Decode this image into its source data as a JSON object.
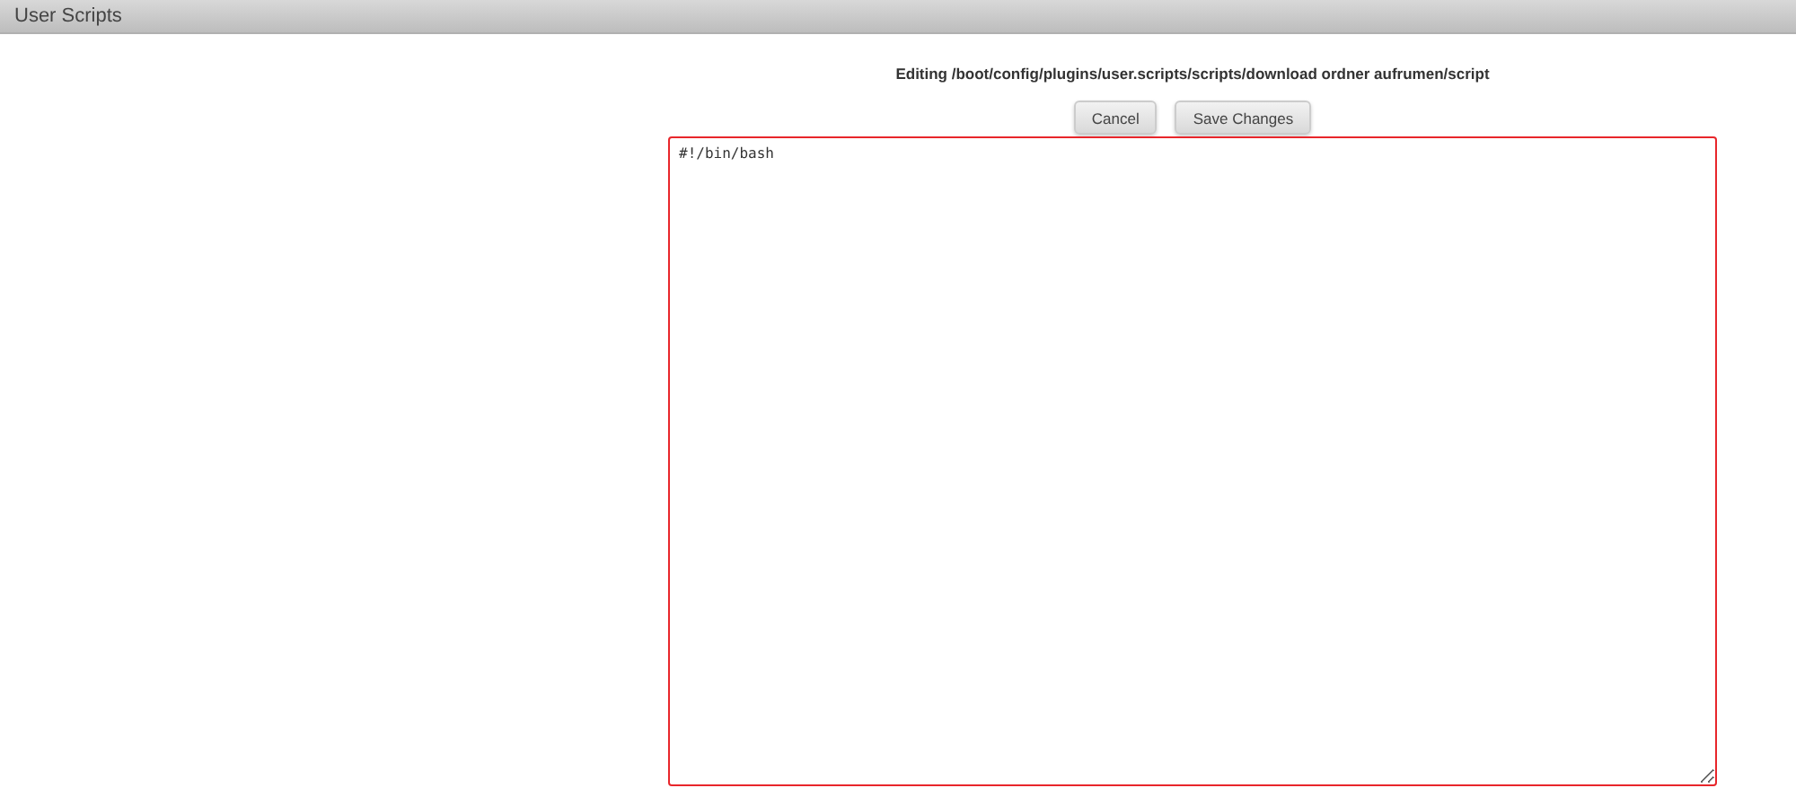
{
  "window": {
    "title": "User Scripts"
  },
  "heading": "Editing /boot/config/plugins/user.scripts/scripts/download ordner aufrumen/script",
  "buttons": [
    "Cancel",
    "Save Changes"
  ],
  "editor": {
    "value": "#!/bin/bash"
  }
}
